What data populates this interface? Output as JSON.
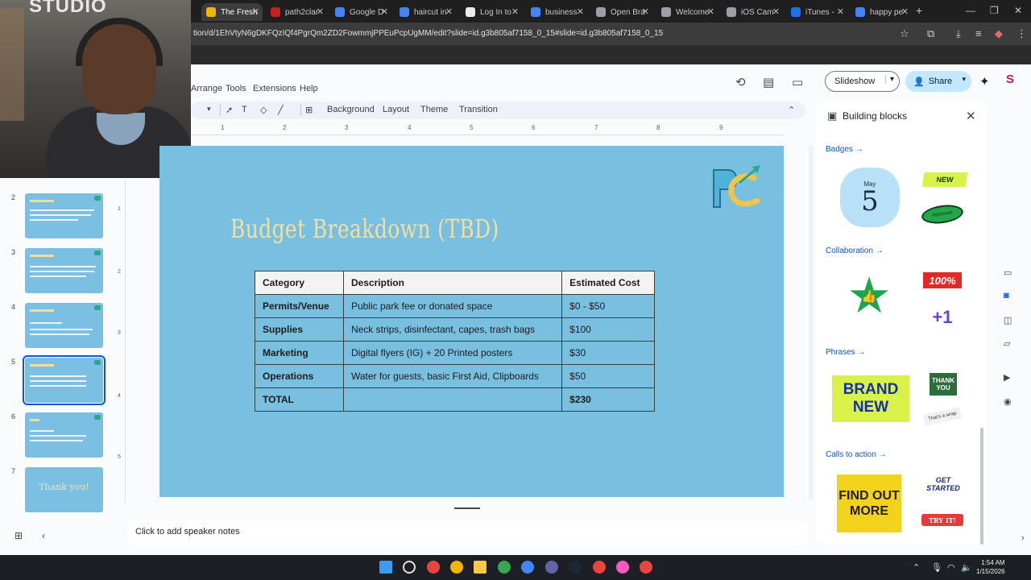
{
  "browser": {
    "tabs": [
      {
        "label": "The Fresh"
      },
      {
        "label": "path2clar"
      },
      {
        "label": "Google D"
      },
      {
        "label": "haircut in"
      },
      {
        "label": "Log In to"
      },
      {
        "label": "business"
      },
      {
        "label": "Open Bra"
      },
      {
        "label": "Welcome"
      },
      {
        "label": "iOS Cam"
      },
      {
        "label": "iTunes -"
      },
      {
        "label": "happy pe"
      }
    ],
    "url": "tion/d/1EhVtyN6gDKFQzIQf4PgrQm2ZD2FowmmjPPEuPcpUgMM/edit?slide=id.g3b805af7158_0_15#slide=id.g3b805af7158_0_15"
  },
  "webcam": {
    "overlay_text": "STUDIO"
  },
  "menus": [
    "Arrange",
    "Tools",
    "Extensions",
    "Help"
  ],
  "header": {
    "slideshow_label": "Slideshow",
    "share_label": "Share"
  },
  "toolbar": {
    "background": "Background",
    "layout": "Layout",
    "theme": "Theme",
    "transition": "Transition"
  },
  "ruler": {
    "h": [
      "1",
      "2",
      "3",
      "4",
      "5",
      "6",
      "7",
      "8",
      "9"
    ],
    "v": [
      "1",
      "2",
      "3",
      "4",
      "5"
    ]
  },
  "filmstrip": {
    "numbers": [
      "2",
      "3",
      "4",
      "5",
      "6",
      "7"
    ],
    "last_thumb_text": "Thank you!"
  },
  "slide": {
    "title": "Budget Breakdown (TBD)",
    "headers": [
      "Category",
      "Description",
      "Estimated Cost"
    ],
    "rows": [
      [
        "Permits/Venue",
        "Public park fee or donated space",
        "$0 - $50"
      ],
      [
        "Supplies",
        "Neck strips, disinfectant, capes, trash bags",
        "$100"
      ],
      [
        "Marketing",
        "Digital flyers (IG) + 20 Printed posters",
        "$30"
      ],
      [
        "Operations",
        "Water for guests, basic First Aid, Clipboards",
        "$50"
      ],
      [
        "TOTAL",
        "",
        "$230"
      ]
    ]
  },
  "notes": {
    "placeholder": "Click to add speaker notes"
  },
  "panel": {
    "title": "Building blocks",
    "sections": [
      "Badges",
      "Collaboration",
      "Phrases",
      "Calls to action"
    ],
    "badges": {
      "month": "May",
      "day": "5",
      "new": "NEW",
      "approved": "Approved"
    },
    "collab": {
      "percent": "100%",
      "plus": "+1"
    },
    "phrases": {
      "brand": "BRAND NEW",
      "thank": "THANK YOU",
      "wrap": "That's a wrap"
    },
    "cta": {
      "find": "FIND OUT MORE",
      "get": "GET STARTED",
      "try": "TRY IT!"
    }
  },
  "clock": {
    "time": "1:54 AM",
    "date": "1/15/2026"
  },
  "colors": {
    "slide_bg": "#78bfe0",
    "title": "#f5dfa0",
    "share_bg": "#c2e7ff",
    "accent": "#0b57d0"
  }
}
